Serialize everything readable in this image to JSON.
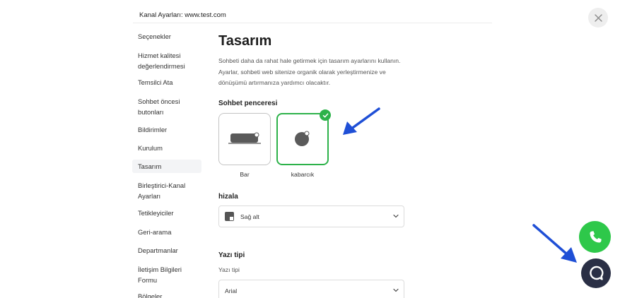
{
  "header": {
    "title": "Kanal Ayarları: www.test.com"
  },
  "sidebar": {
    "items": [
      {
        "label": "Seçenekler"
      },
      {
        "label": "Hizmet kalitesi değerlendirmesi"
      },
      {
        "label": "Temsilci Ata"
      },
      {
        "label": "Sohbet öncesi butonları"
      },
      {
        "label": "Bildirimler"
      },
      {
        "label": "Kurulum"
      },
      {
        "label": "Tasarım"
      },
      {
        "label": "Birleştirici-Kanal Ayarları"
      },
      {
        "label": "Tetikleyiciler"
      },
      {
        "label": "Geri-arama"
      },
      {
        "label": "Departmanlar"
      },
      {
        "label": "İletişim Bilgileri Formu"
      },
      {
        "label": "Bölgeler"
      }
    ]
  },
  "main": {
    "title": "Tasarım",
    "description": "Sohbeti daha da rahat hale getirmek için tasarım ayarlarını kullanın. Ayarlar, sohbeti web sitenize organik olarak yerleştirmenize ve dönüşümü artırmanıza yardımcı olacaktır.",
    "chat_window": {
      "label": "Sohbet penceresi",
      "options": [
        {
          "label": "Bar",
          "icon": "bar-widget-icon",
          "selected": false
        },
        {
          "label": "kabarcık",
          "icon": "bubble-widget-icon",
          "selected": true
        }
      ]
    },
    "align": {
      "label": "hizala",
      "value": "Sağ alt",
      "icon": "bottom-right-align-icon"
    },
    "font": {
      "section_label": "Yazı tipi",
      "field_label": "Yazı tipi",
      "value": "Arial"
    }
  },
  "colors": {
    "accent_green": "#2db24a",
    "whatsapp_green": "#2ec84a",
    "chat_button": "#2a2f45",
    "annotation_arrow": "#1f4fd6"
  }
}
